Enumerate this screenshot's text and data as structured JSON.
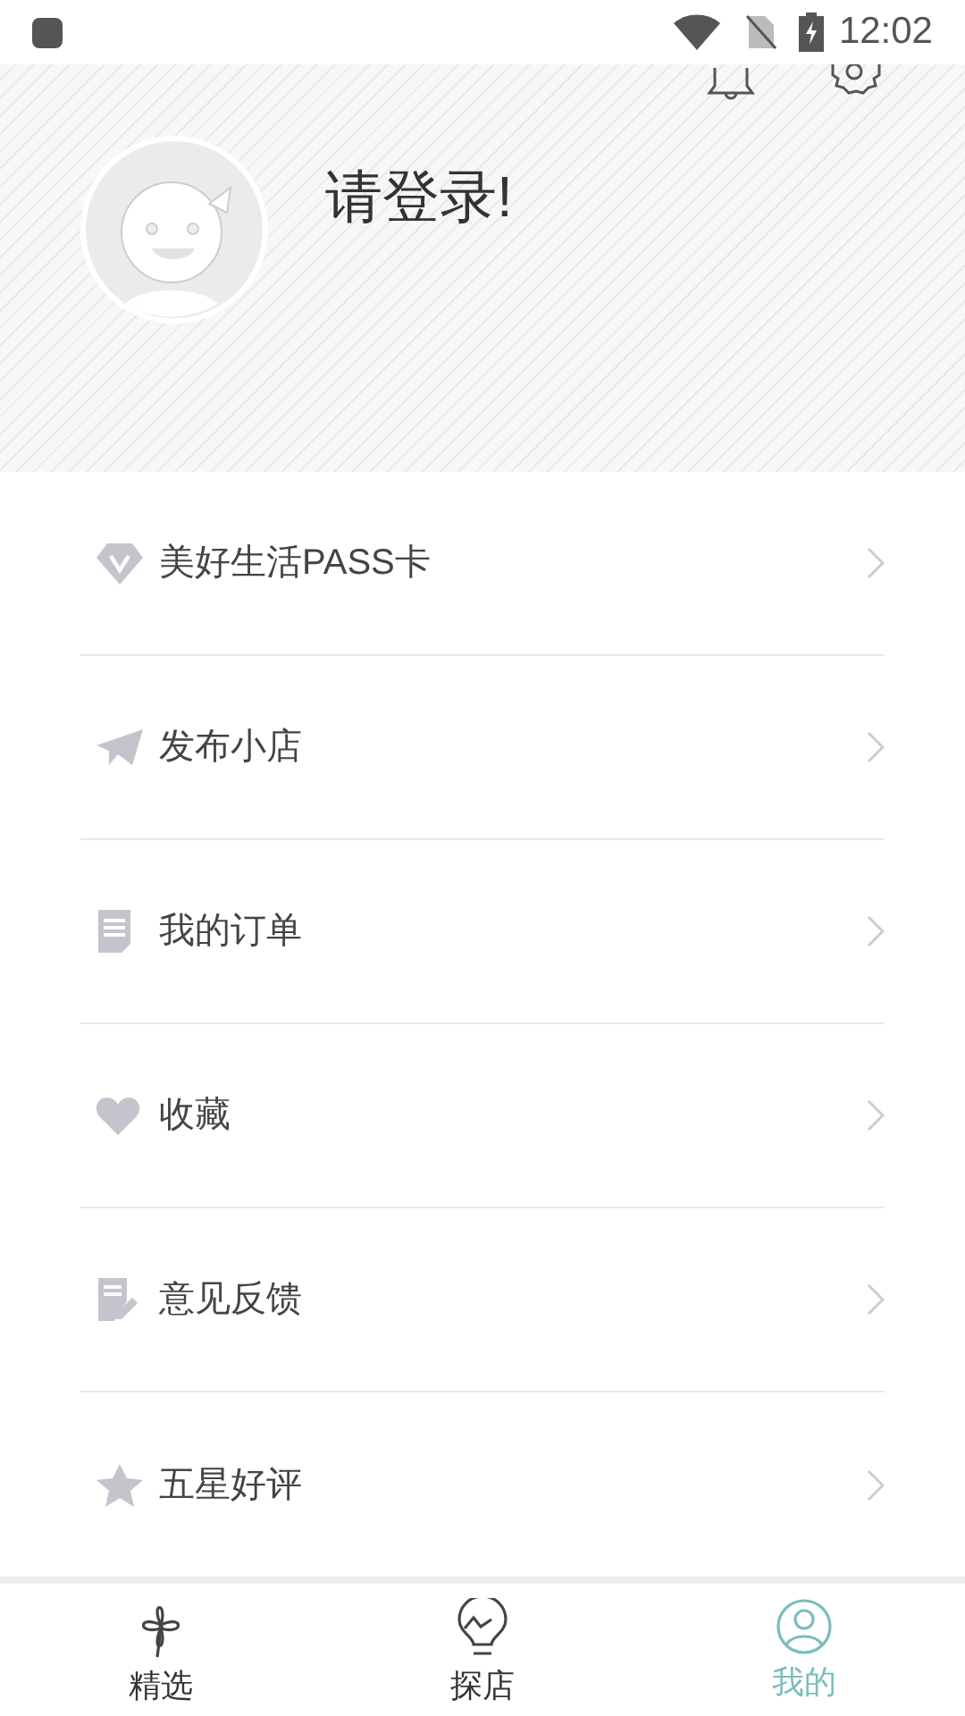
{
  "status_bar": {
    "time": "12:02"
  },
  "header": {
    "login_prompt": "请登录!"
  },
  "menu": [
    {
      "label": "美好生活PASS卡"
    },
    {
      "label": "发布小店"
    },
    {
      "label": "我的订单"
    },
    {
      "label": "收藏"
    },
    {
      "label": "意见反馈"
    },
    {
      "label": "五星好评"
    }
  ],
  "tabs": [
    {
      "label": "精选",
      "selected": false
    },
    {
      "label": "探店",
      "selected": false
    },
    {
      "label": "我的",
      "selected": true
    }
  ]
}
